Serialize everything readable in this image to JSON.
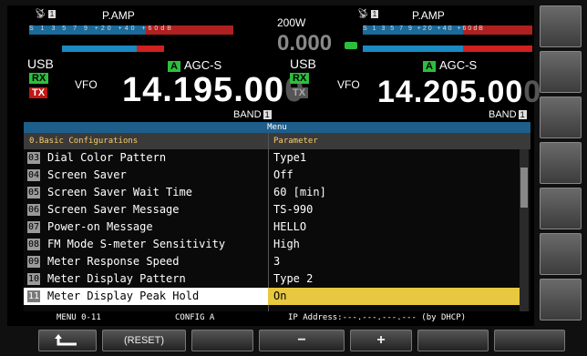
{
  "vfo_a": {
    "antenna": "1",
    "pamp": "P.AMP",
    "scale_text": "S  1  3  5  7  9   +20  +40 +60dB",
    "mode": "USB",
    "rx": "RX",
    "tx": "TX",
    "vfo": "VFO",
    "agc_badge": "A",
    "agc": "AGC-S",
    "freq_main": "14.195.00",
    "freq_dim": "0",
    "band": "BAND",
    "band_num": "1"
  },
  "center": {
    "power": "200W",
    "counter": "0.000"
  },
  "vfo_b": {
    "antenna": "1",
    "pamp": "P.AMP",
    "scale_text": "S  1  3  5  7  9   +20  +40 +60dB",
    "mode": "USB",
    "rx": "RX",
    "tx": "TX",
    "vfo": "VFO",
    "agc_badge": "A",
    "agc": "AGC-S",
    "freq_main": "14.205.00",
    "freq_dim": "0",
    "band": "BAND",
    "band_num": "1"
  },
  "menu": {
    "title": "Menu",
    "group": "0.Basic Configurations",
    "param_header": "Parameter",
    "rows": [
      {
        "num": "03",
        "name": "Dial Color Pattern",
        "value": "Type1"
      },
      {
        "num": "04",
        "name": "Screen Saver",
        "value": "Off"
      },
      {
        "num": "05",
        "name": "Screen Saver Wait Time",
        "value": "60 [min]"
      },
      {
        "num": "06",
        "name": "Screen Saver Message",
        "value": "TS-990"
      },
      {
        "num": "07",
        "name": "Power-on Message",
        "value": "HELLO"
      },
      {
        "num": "08",
        "name": "FM Mode S-meter Sensitivity",
        "value": "High"
      },
      {
        "num": "09",
        "name": "Meter Response Speed",
        "value": "3"
      },
      {
        "num": "10",
        "name": "Meter Display Pattern",
        "value": "Type 2"
      },
      {
        "num": "11",
        "name": "Meter Display Peak Hold",
        "value": "On"
      }
    ]
  },
  "status": {
    "menu_no": "MENU 0-11",
    "config": "CONFIG A",
    "ip": "IP Address:---.---.---.--- (by DHCP)"
  },
  "keys": {
    "back_icon": "return-arrow-icon",
    "reset": "(RESET)",
    "minus": "−",
    "plus": "+"
  },
  "colors": {
    "rx": "#2cbf3c",
    "tx": "#c01818",
    "selected_value": "#e8c840",
    "menu_title": "#1e5e8a"
  }
}
